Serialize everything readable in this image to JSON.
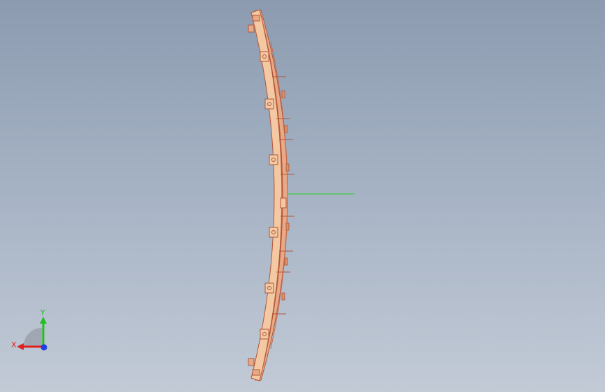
{
  "viewport": {
    "background_top": "#8c9bb0",
    "background_bottom": "#c2cad6"
  },
  "model": {
    "part_color": "#f3c8a2",
    "edge_color": "#b0583a",
    "shade_color": "#d9906c",
    "axis_line_color": "#22cc22"
  },
  "triad": {
    "x_label": "X",
    "y_label": "Y",
    "x_color": "#e02020",
    "y_color": "#20c020",
    "z_color": "#2040e0"
  }
}
